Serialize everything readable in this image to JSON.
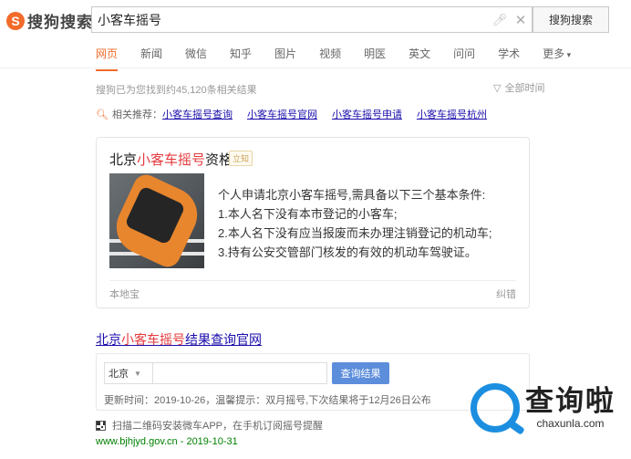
{
  "brand": {
    "mark": "S",
    "name": "搜狗搜索"
  },
  "search": {
    "query": "小客车摇号",
    "button_label": "搜狗搜索"
  },
  "tabs": [
    {
      "label": "网页"
    },
    {
      "label": "新闻"
    },
    {
      "label": "微信"
    },
    {
      "label": "知乎"
    },
    {
      "label": "图片"
    },
    {
      "label": "视频"
    },
    {
      "label": "明医"
    },
    {
      "label": "英文"
    },
    {
      "label": "问问"
    },
    {
      "label": "学术"
    },
    {
      "label": "更多"
    }
  ],
  "results_info": {
    "count_text": "搜狗已为您找到约45,120条相关结果",
    "time_filter": "全部时间"
  },
  "related": {
    "label": "相关推荐：",
    "items": [
      "小客车摇号查询",
      "小客车摇号官网",
      "小客车摇号申请",
      "小客车摇号杭州"
    ]
  },
  "card": {
    "title_prefix": "北京",
    "title_highlight": "小客车摇号",
    "title_suffix": "资格",
    "badge": "立知",
    "lines": [
      "个人申请北京小客车摇号,需具备以下三个基本条件:",
      "1.本人名下没有本市登记的小客车;",
      "2.本人名下没有应当报废而未办理注销登记的机动车;",
      "3.持有公安交管部门核发的有效的机动车驾驶证。"
    ],
    "source": "本地宝",
    "report": "纠错"
  },
  "result2": {
    "title_prefix": "北京",
    "title_highlight": "小客车摇号",
    "title_suffix": "结果查询官网",
    "city": "北京",
    "query_button": "查询结果",
    "update_info": "更新时间：2019-10-26，温馨提示：双月摇号,下次结果将于12月26日公布",
    "qr_text": "扫描二维码安装微车APP，在手机订阅摇号提醒",
    "url": "www.bjhjyd.gov.cn - 2019-10-31"
  },
  "watermark": {
    "name": "查询啦",
    "domain": "chaxunla.com"
  },
  "colors": {
    "accent": "#f26b2b",
    "link": "#1a0dab",
    "highlight": "#e4393c",
    "url_green": "#008000",
    "button_blue": "#5d8edb"
  }
}
